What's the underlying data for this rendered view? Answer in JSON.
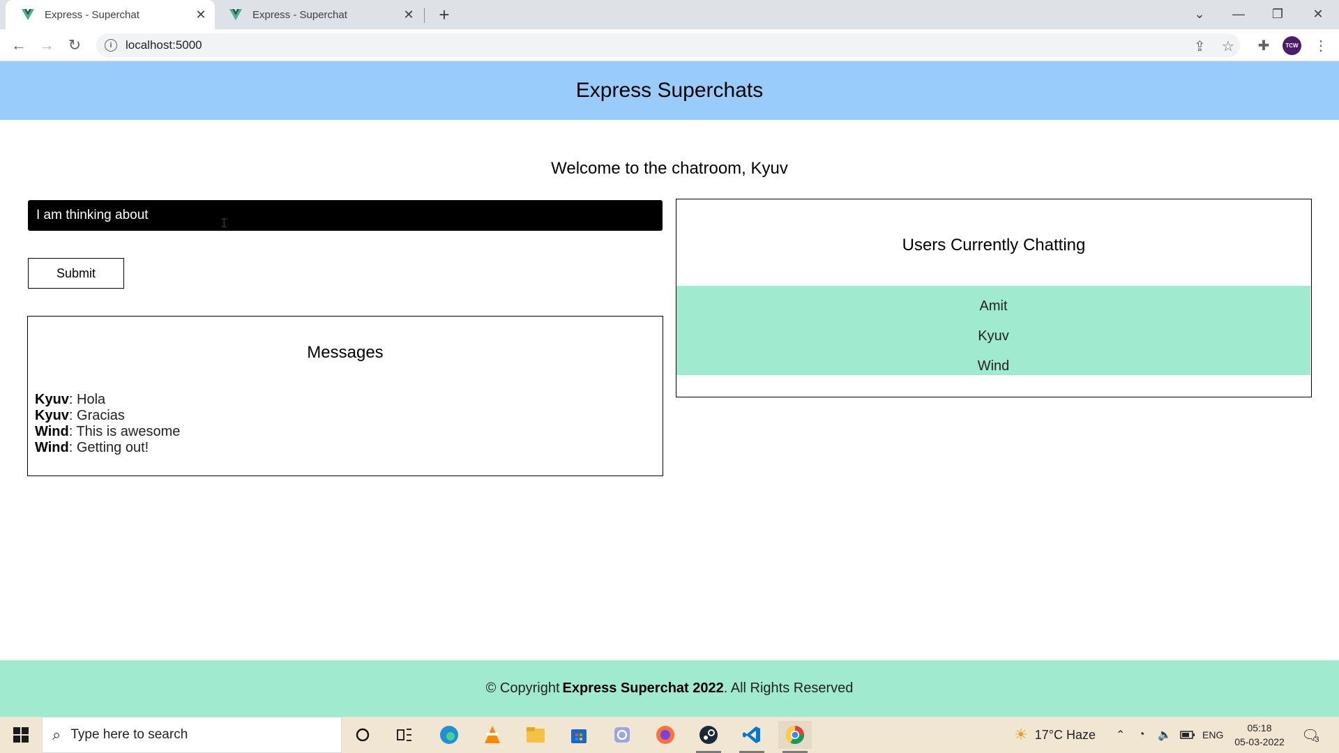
{
  "browser": {
    "tabs": [
      {
        "title": "Express - Superchat",
        "active": true
      },
      {
        "title": "Express - Superchat",
        "active": false
      }
    ],
    "url": "localhost:5000",
    "profile_initials": "TCW"
  },
  "header": {
    "title": "Express Superchats"
  },
  "welcome": "Welcome to the chatroom, Kyuv",
  "message_input": {
    "value": "I am thinking about"
  },
  "submit_label": "Submit",
  "messages": {
    "title": "Messages",
    "items": [
      {
        "user": "Kyuv",
        "text": ": Hola"
      },
      {
        "user": "Kyuv",
        "text": ": Gracias"
      },
      {
        "user": "Wind",
        "text": ": This is awesome"
      },
      {
        "user": "Wind",
        "text": ": Getting out!"
      }
    ]
  },
  "users": {
    "title": "Users Currently Chatting",
    "items": [
      "Amit",
      "Kyuv",
      "Wind"
    ]
  },
  "footer": {
    "prefix": "© Copyright",
    "brand": "Express Superchat 2022",
    "suffix": ". All Rights Reserved"
  },
  "taskbar": {
    "search_placeholder": "Type here to search",
    "weather": "17°C  Haze",
    "language": "ENG",
    "time": "05:18",
    "date": "05-03-2022",
    "notification_count": "3"
  },
  "colors": {
    "header_bg": "#99ccfb",
    "accent_green": "#a0ebcf",
    "input_bg": "#000000"
  }
}
